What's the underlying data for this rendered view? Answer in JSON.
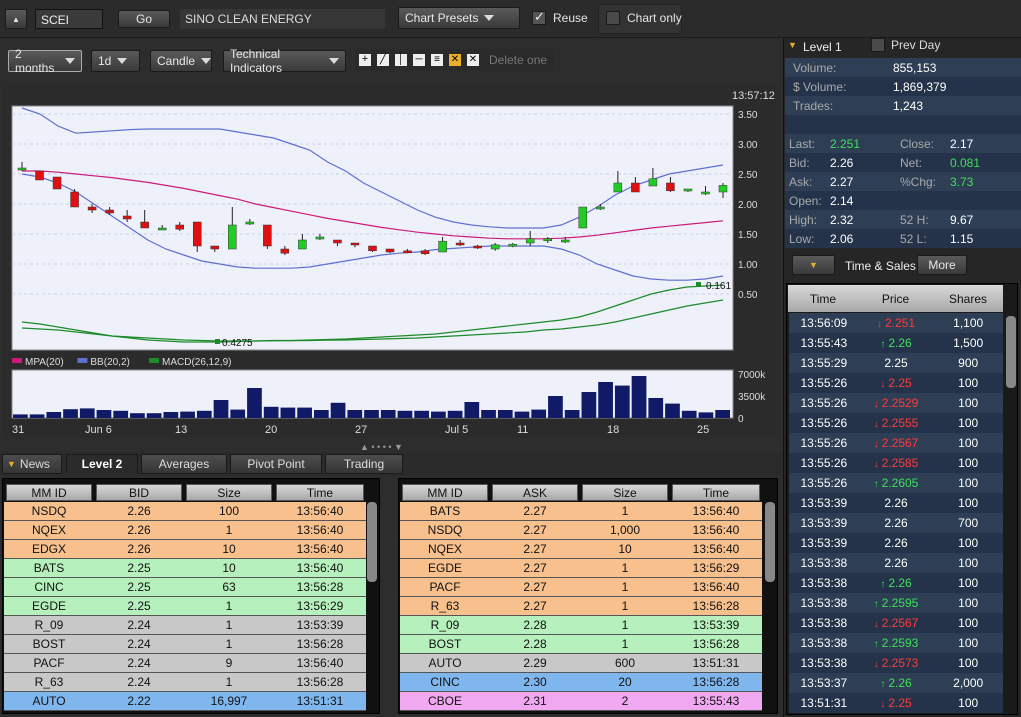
{
  "toolbar": {
    "symbol": "SCEI",
    "go": "Go",
    "company": "SINO CLEAN ENERGY",
    "presets": "Chart Presets",
    "reuse": "Reuse",
    "chart_only": "Chart only"
  },
  "chart_toolbar": {
    "range": "2 months",
    "interval": "1d",
    "style": "Candle",
    "indicators": "Technical Indicators",
    "delete_one": "Delete one"
  },
  "level1": {
    "title": "Level 1",
    "prev_day": "Prev Day",
    "volume_label": "Volume:",
    "volume": "855,153",
    "dvolume_label": "$ Volume:",
    "dvolume": "1,869,379",
    "trades_label": "Trades:",
    "trades": "1,243",
    "last_label": "Last:",
    "last": "2.251",
    "close_label": "Close:",
    "close": "2.17",
    "bid_label": "Bid:",
    "bid": "2.26",
    "net_label": "Net:",
    "net": "0.081",
    "ask_label": "Ask:",
    "ask": "2.27",
    "pchg_label": "%Chg:",
    "pchg": "3.73",
    "open_label": "Open:",
    "open": "2.14",
    "high_label": "High:",
    "high": "2.32",
    "h52_label": "52 H:",
    "h52": "9.67",
    "low_label": "Low:",
    "low": "2.06",
    "l52_label": "52 L:",
    "l52": "1.15"
  },
  "ts": {
    "title": "Time & Sales",
    "more": "More",
    "headers": [
      "Time",
      "Price",
      "Shares"
    ],
    "rows": [
      [
        "13:56:09",
        "2.251",
        "1,100",
        "dn"
      ],
      [
        "13:55:43",
        "2.26",
        "1,500",
        "up"
      ],
      [
        "13:55:29",
        "2.25",
        "900",
        ""
      ],
      [
        "13:55:26",
        "2.25",
        "100",
        "dn"
      ],
      [
        "13:55:26",
        "2.2529",
        "100",
        "dn"
      ],
      [
        "13:55:26",
        "2.2555",
        "100",
        "dn"
      ],
      [
        "13:55:26",
        "2.2567",
        "100",
        "dn"
      ],
      [
        "13:55:26",
        "2.2585",
        "100",
        "dn"
      ],
      [
        "13:55:26",
        "2.2605",
        "100",
        "up"
      ],
      [
        "13:53:39",
        "2.26",
        "100",
        ""
      ],
      [
        "13:53:39",
        "2.26",
        "700",
        ""
      ],
      [
        "13:53:39",
        "2.26",
        "100",
        ""
      ],
      [
        "13:53:38",
        "2.26",
        "100",
        ""
      ],
      [
        "13:53:38",
        "2.26",
        "100",
        "up"
      ],
      [
        "13:53:38",
        "2.2595",
        "100",
        "up"
      ],
      [
        "13:53:38",
        "2.2567",
        "100",
        "dn"
      ],
      [
        "13:53:38",
        "2.2593",
        "100",
        "up"
      ],
      [
        "13:53:38",
        "2.2573",
        "100",
        "dn"
      ],
      [
        "13:53:37",
        "2.26",
        "2,000",
        "up"
      ],
      [
        "13:51:31",
        "2.25",
        "100",
        "dn"
      ]
    ]
  },
  "tabs": [
    "News",
    "Level 2",
    "Averages",
    "Pivot Point",
    "Trading"
  ],
  "bid_table": {
    "headers": [
      "MM ID",
      "BID",
      "Size",
      "Time"
    ],
    "rows": [
      [
        "NSDQ",
        "2.26",
        "100",
        "13:56:40",
        "#f7c08d"
      ],
      [
        "NQEX",
        "2.26",
        "1",
        "13:56:40",
        "#f7c08d"
      ],
      [
        "EDGX",
        "2.26",
        "10",
        "13:56:40",
        "#f7c08d"
      ],
      [
        "BATS",
        "2.25",
        "10",
        "13:56:40",
        "#b5f0bd"
      ],
      [
        "CINC",
        "2.25",
        "63",
        "13:56:28",
        "#b5f0bd"
      ],
      [
        "EGDE",
        "2.25",
        "1",
        "13:56:29",
        "#b5f0bd"
      ],
      [
        "R_09",
        "2.24",
        "1",
        "13:53:39",
        "#c8c8c8"
      ],
      [
        "BOST",
        "2.24",
        "1",
        "13:56:28",
        "#c8c8c8"
      ],
      [
        "PACF",
        "2.24",
        "9",
        "13:56:40",
        "#c8c8c8"
      ],
      [
        "R_63",
        "2.24",
        "1",
        "13:56:28",
        "#c8c8c8"
      ],
      [
        "AUTO",
        "2.22",
        "16,997",
        "13:51:31",
        "#7fb6ee"
      ]
    ]
  },
  "ask_table": {
    "headers": [
      "MM ID",
      "ASK",
      "Size",
      "Time"
    ],
    "rows": [
      [
        "BATS",
        "2.27",
        "1",
        "13:56:40",
        "#f7c08d"
      ],
      [
        "NSDQ",
        "2.27",
        "1,000",
        "13:56:40",
        "#f7c08d"
      ],
      [
        "NQEX",
        "2.27",
        "10",
        "13:56:40",
        "#f7c08d"
      ],
      [
        "EGDE",
        "2.27",
        "1",
        "13:56:29",
        "#f7c08d"
      ],
      [
        "PACF",
        "2.27",
        "1",
        "13:56:40",
        "#f7c08d"
      ],
      [
        "R_63",
        "2.27",
        "1",
        "13:56:28",
        "#f7c08d"
      ],
      [
        "R_09",
        "2.28",
        "1",
        "13:53:39",
        "#b5f0bd"
      ],
      [
        "BOST",
        "2.28",
        "1",
        "13:56:28",
        "#b5f0bd"
      ],
      [
        "AUTO",
        "2.29",
        "600",
        "13:51:31",
        "#c8c8c8"
      ],
      [
        "CINC",
        "2.30",
        "20",
        "13:56:28",
        "#7fb6ee"
      ],
      [
        "CBOE",
        "2.31",
        "2",
        "13:55:43",
        "#f0a8f0"
      ]
    ]
  },
  "chart_data": {
    "type": "candlestick",
    "time": "13:57:12",
    "yticks": [
      "3.50",
      "3.00",
      "2.50",
      "2.00",
      "1.50",
      "1.00",
      "0.50"
    ],
    "vticks": [
      "7000k",
      "3500k",
      "0"
    ],
    "xticks": [
      "31",
      "Jun 6",
      "13",
      "20",
      "27",
      "Jul 5",
      "11",
      "18",
      "25"
    ],
    "legend": [
      "MPA(20)",
      "BB(20,2)",
      "MACD(26,12,9)"
    ],
    "macd_min_label": "0.4275",
    "macd_last_label": "0.161",
    "candles": [
      [
        2.6,
        2.7,
        2.55,
        2.6
      ],
      [
        2.55,
        2.55,
        2.4,
        2.4
      ],
      [
        2.45,
        2.45,
        2.25,
        2.25
      ],
      [
        2.2,
        2.25,
        1.95,
        1.95
      ],
      [
        1.95,
        2.0,
        1.85,
        1.9
      ],
      [
        1.9,
        1.95,
        1.82,
        1.85
      ],
      [
        1.8,
        1.9,
        1.7,
        1.75
      ],
      [
        1.7,
        1.9,
        1.6,
        1.6
      ],
      [
        1.6,
        1.65,
        1.58,
        1.6
      ],
      [
        1.65,
        1.7,
        1.55,
        1.58
      ],
      [
        1.7,
        1.7,
        1.2,
        1.3
      ],
      [
        1.3,
        1.3,
        1.2,
        1.25
      ],
      [
        1.25,
        1.95,
        1.25,
        1.65
      ],
      [
        1.7,
        1.75,
        1.65,
        1.7
      ],
      [
        1.65,
        1.65,
        1.25,
        1.3
      ],
      [
        1.25,
        1.3,
        1.15,
        1.18
      ],
      [
        1.25,
        1.5,
        1.25,
        1.4
      ],
      [
        1.45,
        1.5,
        1.4,
        1.45
      ],
      [
        1.4,
        1.4,
        1.3,
        1.35
      ],
      [
        1.35,
        1.35,
        1.28,
        1.32
      ],
      [
        1.3,
        1.3,
        1.2,
        1.22
      ],
      [
        1.25,
        1.25,
        1.18,
        1.2
      ],
      [
        1.22,
        1.25,
        1.18,
        1.2
      ],
      [
        1.22,
        1.25,
        1.15,
        1.17
      ],
      [
        1.2,
        1.45,
        1.2,
        1.38
      ],
      [
        1.35,
        1.4,
        1.3,
        1.32
      ],
      [
        1.3,
        1.32,
        1.25,
        1.28
      ],
      [
        1.25,
        1.35,
        1.22,
        1.32
      ],
      [
        1.3,
        1.35,
        1.28,
        1.33
      ],
      [
        1.35,
        1.55,
        1.3,
        1.42
      ],
      [
        1.4,
        1.45,
        1.35,
        1.42
      ],
      [
        1.4,
        1.45,
        1.35,
        1.4
      ],
      [
        1.6,
        1.95,
        1.6,
        1.95
      ],
      [
        1.95,
        2.0,
        1.9,
        1.95
      ],
      [
        2.2,
        2.55,
        2.2,
        2.35
      ],
      [
        2.35,
        2.45,
        2.2,
        2.2
      ],
      [
        2.3,
        2.6,
        2.3,
        2.42
      ],
      [
        2.35,
        2.45,
        2.2,
        2.22
      ],
      [
        2.25,
        2.25,
        2.2,
        2.25
      ],
      [
        2.2,
        2.3,
        2.15,
        2.2
      ],
      [
        2.2,
        2.35,
        2.1,
        2.31
      ]
    ],
    "volume": [
      900,
      900,
      1500,
      2200,
      2400,
      2000,
      1800,
      1200,
      1200,
      1500,
      1600,
      1800,
      4500,
      2100,
      7500,
      2800,
      2600,
      2600,
      2000,
      3800,
      2000,
      2000,
      2000,
      1800,
      1800,
      1600,
      1800,
      4000,
      2000,
      2000,
      1600,
      2100,
      5500,
      2000,
      6500,
      9000,
      8100,
      10500,
      5000,
      3600,
      1800,
      1400,
      2000
    ],
    "ma20": [
      2.55,
      2.55,
      2.53,
      2.5,
      2.47,
      2.44,
      2.4,
      2.36,
      2.31,
      2.26,
      2.2,
      2.14,
      2.08,
      2.0,
      1.94,
      1.88,
      1.82,
      1.76,
      1.71,
      1.66,
      1.61,
      1.57,
      1.53,
      1.5,
      1.47,
      1.45,
      1.43,
      1.42,
      1.42,
      1.42,
      1.43,
      1.45,
      1.48,
      1.52,
      1.56,
      1.6,
      1.63,
      1.66,
      1.69,
      1.72
    ],
    "bbu": [
      3.6,
      3.5,
      3.3,
      3.18,
      3.2,
      3.22,
      3.24,
      3.25,
      3.25,
      3.25,
      3.25,
      3.25,
      3.2,
      3.15,
      3.1,
      3.0,
      2.9,
      2.7,
      2.55,
      2.35,
      2.2,
      2.05,
      1.9,
      1.78,
      1.7,
      1.65,
      1.62,
      1.6,
      1.6,
      1.6,
      1.65,
      1.78,
      1.95,
      2.15,
      2.3,
      2.4,
      2.5,
      2.55,
      2.6,
      2.65
    ],
    "bbl": [
      2.5,
      2.45,
      2.35,
      2.2,
      2.0,
      1.8,
      1.6,
      1.4,
      1.25,
      1.15,
      1.05,
      1.0,
      0.95,
      0.93,
      0.93,
      0.93,
      0.95,
      1.0,
      1.05,
      1.1,
      1.15,
      1.18,
      1.2,
      1.24,
      1.26,
      1.28,
      1.3,
      1.3,
      1.3,
      1.3,
      1.25,
      1.15,
      1.0,
      0.9,
      0.8,
      0.75,
      0.73,
      0.73,
      0.75,
      0.8
    ],
    "macd": [
      0.2,
      0.18,
      0.15,
      0.12,
      0.09,
      0.06,
      0.04,
      0.02,
      0.01,
      0.0,
      0.0,
      0.0,
      0.005,
      0.01,
      0.015,
      0.015,
      0.02,
      0.025,
      0.03,
      0.04,
      0.05,
      0.06,
      0.07,
      0.08,
      0.1,
      0.12,
      0.14,
      0.16,
      0.18,
      0.2,
      0.22,
      0.25,
      0.3,
      0.36,
      0.42,
      0.48,
      0.52,
      0.55,
      0.56,
      0.57
    ],
    "signal": [
      0.14,
      0.13,
      0.12,
      0.1,
      0.08,
      0.06,
      0.05,
      0.04,
      0.03,
      0.02,
      0.015,
      0.01,
      0.01,
      0.01,
      0.012,
      0.013,
      0.015,
      0.018,
      0.02,
      0.025,
      0.03,
      0.035,
      0.04,
      0.05,
      0.06,
      0.07,
      0.08,
      0.09,
      0.1,
      0.12,
      0.13,
      0.15,
      0.17,
      0.2,
      0.24,
      0.28,
      0.32,
      0.36,
      0.39,
      0.42
    ]
  },
  "colors": {
    "bull": "#22cc22",
    "bear": "#e01010",
    "ma": "#cc1a7a",
    "bb": "#5f6fd0",
    "macd": "#1d8a2a",
    "volume": "#101a66"
  }
}
